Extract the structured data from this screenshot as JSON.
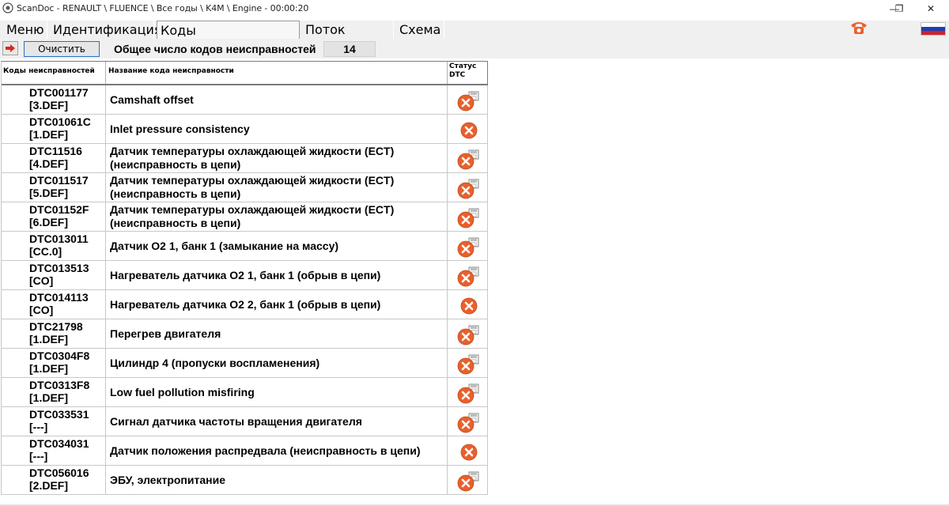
{
  "window": {
    "title": "ScanDoc - RENAULT \\ FLUENCE \\ Все годы \\ K4M \\ Engine - 00:00:20",
    "minimize_symbol": "—",
    "restore_symbol": "❐",
    "close_symbol": "✕"
  },
  "menu": {
    "items": [
      {
        "label": "Меню"
      },
      {
        "label": "Идентификация"
      },
      {
        "label": "Коды неисправностей",
        "active": true
      },
      {
        "label": "Поток данных"
      },
      {
        "label": "Схема"
      }
    ],
    "phone_icon": "phone-icon",
    "flag_icon": "russian-flag-icon"
  },
  "toolbar": {
    "clear_label": "Очистить",
    "total_label": "Общее число кодов неисправностей",
    "total_count": "14"
  },
  "table": {
    "headers": {
      "code": "Коды неисправностей",
      "name": "Название кода неисправности",
      "status_line1": "Статус",
      "status_line2": "DTC"
    },
    "rows": [
      {
        "code": "DTC001177",
        "sub": "[3.DEF]",
        "name": "Camshaft offset",
        "status": "stored"
      },
      {
        "code": "DTC01061C",
        "sub": "[1.DEF]",
        "name": "Inlet pressure consistency",
        "status": "active"
      },
      {
        "code": "DTC11516",
        "sub": "[4.DEF]",
        "name": "Датчик температуры охлаждающей жидкости (ECT) (неисправность в цепи)",
        "status": "stored"
      },
      {
        "code": "DTC011517",
        "sub": "[5.DEF]",
        "name": "Датчик температуры охлаждающей жидкости (ECT) (неисправность в цепи)",
        "status": "stored"
      },
      {
        "code": "DTC01152F",
        "sub": "[6.DEF]",
        "name": "Датчик температуры охлаждающей жидкости (ECT) (неисправность в цепи)",
        "status": "stored"
      },
      {
        "code": "DTC013011",
        "sub": "[CC.0]",
        "name": "Датчик O2 1, банк 1 (замыкание на массу)",
        "status": "stored"
      },
      {
        "code": "DTC013513",
        "sub": "[CO]",
        "name": "Нагреватель датчика O2 1, банк 1 (обрыв в цепи)",
        "status": "stored"
      },
      {
        "code": "DTC014113",
        "sub": "[CO]",
        "name": "Нагреватель датчика O2 2, банк 1 (обрыв в цепи)",
        "status": "active"
      },
      {
        "code": "DTC21798",
        "sub": "[1.DEF]",
        "name": "Перегрев двигателя",
        "status": "stored"
      },
      {
        "code": "DTC0304F8",
        "sub": "[1.DEF]",
        "name": "Цилиндр 4 (пропуски воспламенения)",
        "status": "stored"
      },
      {
        "code": "DTC0313F8",
        "sub": "[1.DEF]",
        "name": "Low fuel pollution misfiring",
        "status": "stored"
      },
      {
        "code": "DTC033531",
        "sub": "[---]",
        "name": "Сигнал датчика частоты вращения двигателя",
        "status": "stored"
      },
      {
        "code": "DTC034031",
        "sub": "[---]",
        "name": "Датчик положения распредвала (неисправность в цепи)",
        "status": "active"
      },
      {
        "code": "DTC056016",
        "sub": "[2.DEF]",
        "name": "ЭБУ, электропитание",
        "status": "stored"
      }
    ]
  },
  "colors": {
    "error_icon": "#e8602c",
    "clear_button_border": "#2a6fc9",
    "phone": "#e8602c"
  }
}
